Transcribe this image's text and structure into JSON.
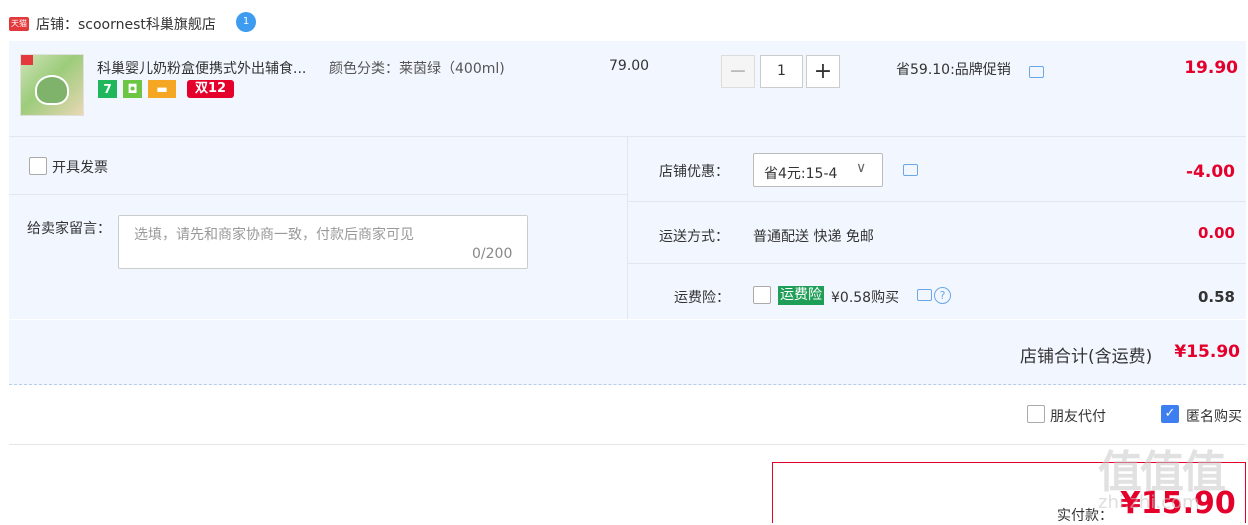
{
  "shop": {
    "badge": "天猫",
    "name": "店铺：scoornest科巢旗舰店",
    "ww_badge": "1"
  },
  "item": {
    "title": "科巢婴儿奶粉盒便携式外出辅食...",
    "sku": "颜色分类：莱茵绿（400ml)",
    "badges": [
      "7",
      "双12"
    ],
    "price": "79.00",
    "qty": {
      "minus": "−",
      "value": "1",
      "plus": "+"
    },
    "save": "省59.10:品牌促销",
    "subtotal": "19.90"
  },
  "options": {
    "invoice_label": "开具发票",
    "message_label": "给卖家留言：",
    "message_placeholder": "选填，请先和商家协商一致，付款后商家可见",
    "message_count": "0/200",
    "coupon_label": "店铺优惠：",
    "coupon_value": "省4元:15-4",
    "coupon_chevron": "∨",
    "coupon_amount": "-4.00",
    "shipping_label": "运送方式：",
    "shipping_value": "普通配送 快递 免邮",
    "shipping_amount": "0.00",
    "insurance_label": "运费险：",
    "insurance_tag": "运费险",
    "insurance_text": "¥0.58购买",
    "insurance_help": "?",
    "insurance_amount": "0.58"
  },
  "total": {
    "label": "店铺合计(含运费)",
    "amount": "¥15.90"
  },
  "checkout": {
    "friend_pay": "朋友代付",
    "anonymous": "匿名购买",
    "anon_check": "✓",
    "pay_label": "实付款：",
    "pay_amount": "¥15.90"
  },
  "watermark": {
    "main": "值值值",
    "sub": "zhi.zhi.com"
  },
  "colors": {
    "accent_red": "#e4002b",
    "panel_bg": "#f2f7ff",
    "check_blue": "#3d7ff0",
    "insurance_green": "#1f9e58"
  }
}
